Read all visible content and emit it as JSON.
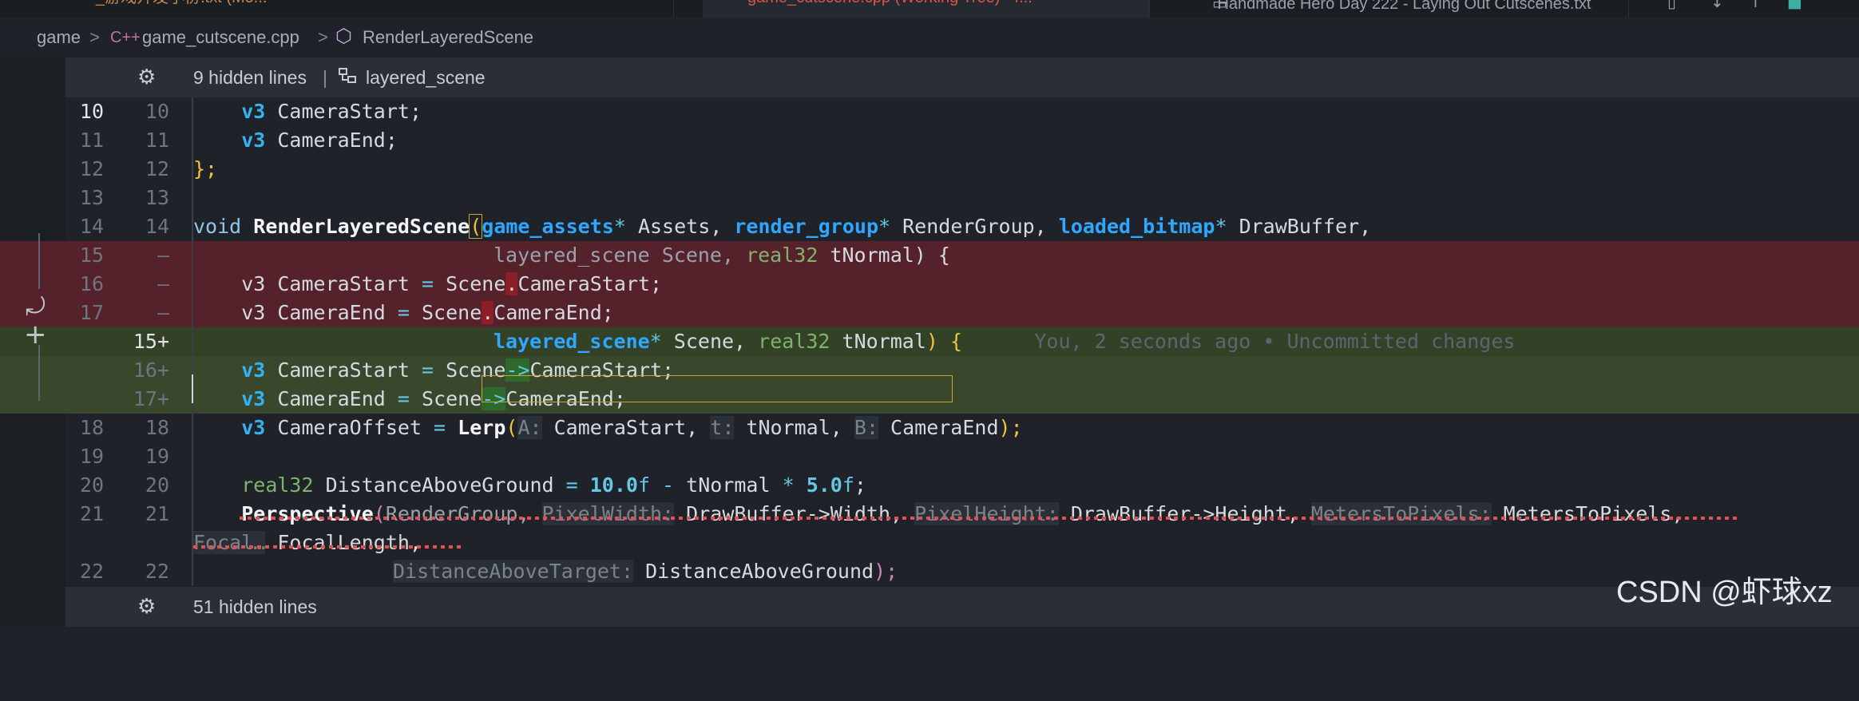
{
  "tabs": [
    {
      "label": "_游戏开发小份.txt (Mo...",
      "state": "modified"
    },
    {
      "label": "game_cutscene.cpp (Working Tree) • f...",
      "state": "active"
    },
    {
      "label": "Handmade Hero Day 222 - Laying Out Cutscenes.txt",
      "state": "normal"
    }
  ],
  "breadcrumb": {
    "folder": "game",
    "file": "game_cutscene.cpp",
    "symbol": "RenderLayeredScene",
    "file_icon": "C++",
    "separator": ">"
  },
  "folds": {
    "top": {
      "label": "9 hidden lines",
      "separator": "|",
      "symbol": "layered_scene"
    },
    "bottom": {
      "label": "51 hidden lines"
    }
  },
  "lines": {
    "l10": {
      "old": "10",
      "new": "10"
    },
    "l11": {
      "old": "11",
      "new": "11"
    },
    "l12": {
      "old": "12",
      "new": "12"
    },
    "l13": {
      "old": "13",
      "new": "13"
    },
    "l14": {
      "old": "14",
      "new": "14"
    },
    "l15": {
      "old": "15",
      "new": "—"
    },
    "l16": {
      "old": "16",
      "new": "—"
    },
    "l17": {
      "old": "17",
      "new": "—"
    },
    "a15": {
      "old": "",
      "new": "15+"
    },
    "a16": {
      "old": "",
      "new": "16+"
    },
    "a17": {
      "old": "",
      "new": "17+"
    },
    "l18": {
      "old": "18",
      "new": "18"
    },
    "l19": {
      "old": "19",
      "new": "19"
    },
    "l20": {
      "old": "20",
      "new": "20"
    },
    "l21": {
      "old": "21",
      "new": "21"
    },
    "l22": {
      "old": "22",
      "new": "22"
    }
  },
  "code": {
    "l10": {
      "type": "v3",
      "rest": " CameraStart;"
    },
    "l11": {
      "type": "v3",
      "rest": " CameraEnd;"
    },
    "l12": {
      "text": "};"
    },
    "l14": {
      "void": "void ",
      "fn": "RenderLayeredScene",
      "paren": "(",
      "t1": "game_assets",
      "s1": "*",
      "p1": " Assets, ",
      "t2": "render_group",
      "s2": "*",
      "p2": " RenderGroup, ",
      "t3": "loaded_bitmap",
      "s3": "*",
      "p3": " DrawBuffer,"
    },
    "l15": {
      "a": "layered_scene Scene, ",
      "b": "real32",
      "c": " tNormal) {"
    },
    "l16": {
      "a": "v3 CameraStart ",
      "eq": "=",
      "b": " Scene",
      "dot": ".",
      "c": "CameraStart;"
    },
    "l17": {
      "a": "v3 CameraEnd ",
      "eq": "=",
      "b": " Scene",
      "dot": ".",
      "c": "CameraEnd;"
    },
    "a15": {
      "t": "layered_scene",
      "s": "*",
      "p": " Scene, ",
      "r": "real32",
      "v": " tNormal",
      "cp": ")",
      "ob": " {",
      "blame": "You, 2 seconds ago • Uncommitted changes"
    },
    "a16": {
      "type": "v3",
      "a": " CameraStart ",
      "eq": "=",
      "b": " Scene",
      "arrow": "->",
      "c": "CameraStart;"
    },
    "a17": {
      "type": "v3",
      "a": " CameraEnd ",
      "eq": "=",
      "b": " Scene",
      "arrow": "->",
      "c": "CameraEnd;"
    },
    "l18": {
      "type": "v3",
      "a": " CameraOffset ",
      "eq": "=",
      "fn": " Lerp",
      "op": "(",
      "h1": "A:",
      "v1": " CameraStart, ",
      "h2": "t:",
      "v2": " tNormal, ",
      "h3": "B:",
      "v3": " CameraEnd",
      "cp": ");"
    },
    "l20": {
      "type": "real32",
      "a": " DistanceAboveGround ",
      "eq": "=",
      "n1": " 10.0",
      "f1": "f",
      "m": " - ",
      "v": "tNormal ",
      "mul": "*",
      "n2": " 5.0",
      "f2": "f",
      "end": ";"
    },
    "l21": {
      "fn": "Perspective",
      "op": "(",
      "a": "RenderGroup, ",
      "h1": "PixelWidth:",
      "v1": " DrawBuffer->Width, ",
      "h2": "PixelHeight:",
      "v2": " DrawBuffer->Height, ",
      "h3": "MetersToPixels:",
      "v3": " MetersToPixels,"
    },
    "l21b": {
      "h": "Focal…",
      "v": " FocalLength,"
    },
    "l22": {
      "h": "DistanceAboveTarget:",
      "v": " DistanceAboveGround",
      "cp": ");"
    }
  },
  "watermark": "CSDN @虾球xz",
  "colors": {
    "deleted": "#55222b",
    "added": "#39482c",
    "keyword": "#33b4f0"
  }
}
